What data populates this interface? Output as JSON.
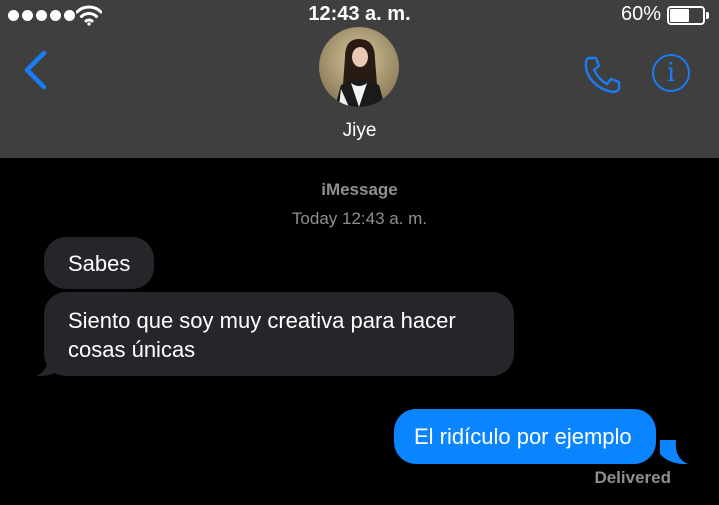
{
  "status_bar": {
    "time": "12:43 a. m.",
    "battery_percent": "60%",
    "battery_level": 0.6,
    "signal_bars": 5
  },
  "nav": {
    "contact_name": "Jiye",
    "accent_color": "#1a7cf5",
    "info_glyph": "i"
  },
  "thread": {
    "service_label": "iMessage",
    "timestamp": "Today 12:43 a. m.",
    "messages": [
      {
        "direction": "incoming",
        "text": "Sabes"
      },
      {
        "direction": "incoming",
        "text": "Siento que soy muy creativa para hacer cosas únicas"
      },
      {
        "direction": "outgoing",
        "text": "El ridículo por ejemplo"
      }
    ],
    "delivery_status": "Delivered"
  },
  "colors": {
    "header_bg": "#3f3f3f",
    "incoming_bubble": "#26252a",
    "outgoing_bubble": "#0b84ff",
    "secondary_text": "#8e8e93"
  }
}
